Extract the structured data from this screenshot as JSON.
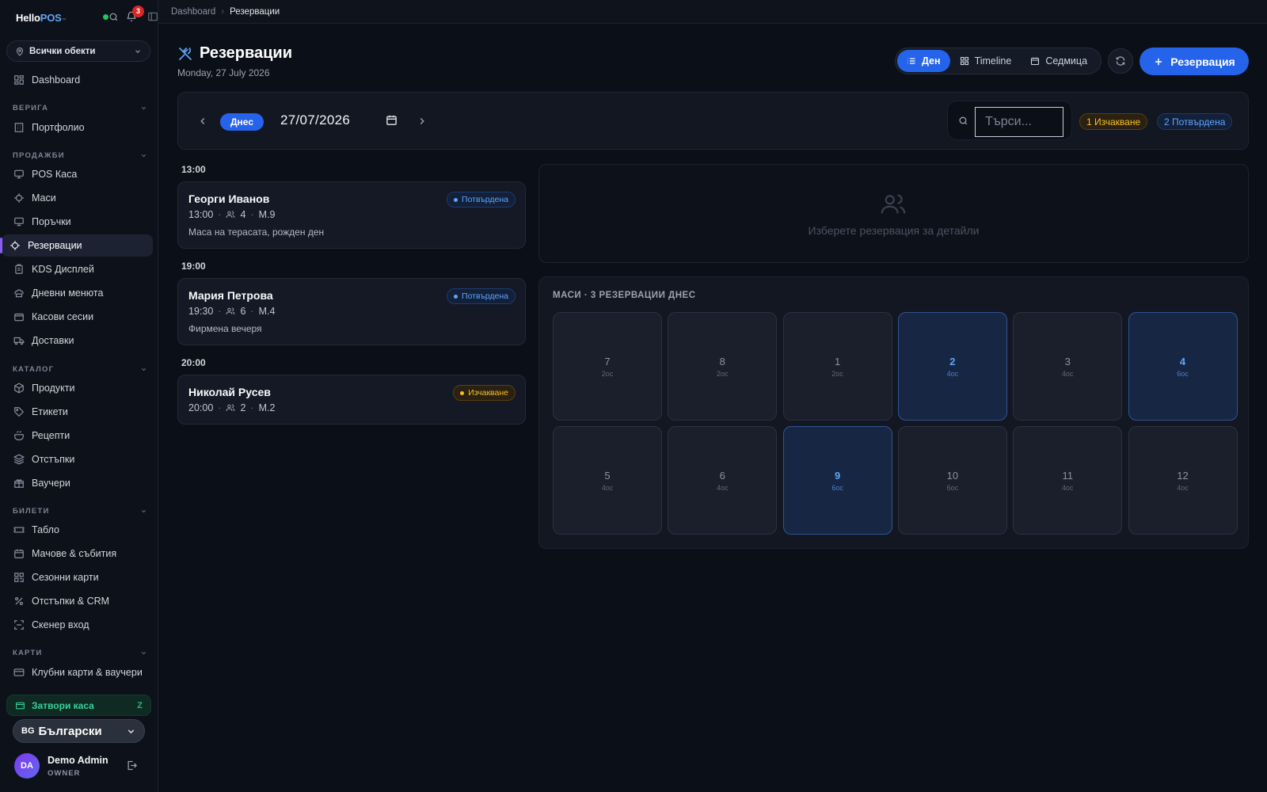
{
  "sidebar": {
    "logo_main": "Hello",
    "logo_accent": "POS",
    "logo_tm": "™",
    "notifications_count": "3",
    "venue_selector": "Всички обекти",
    "dashboard": "Dashboard",
    "sections": [
      {
        "title": "ВЕРИГА",
        "items": [
          "Портфолио"
        ]
      },
      {
        "title": "ПРОДАЖБИ",
        "items": [
          "POS Каса",
          "Маси",
          "Поръчки",
          "Резервации",
          "KDS Дисплей",
          "Дневни менюта",
          "Касови сесии",
          "Доставки"
        ]
      },
      {
        "title": "КАТАЛОГ",
        "items": [
          "Продукти",
          "Етикети",
          "Рецепти",
          "Отстъпки",
          "Ваучери"
        ]
      },
      {
        "title": "БИЛЕТИ",
        "items": [
          "Табло",
          "Мачове & събития",
          "Сезонни карти",
          "Отстъпки & CRM",
          "Скенер вход"
        ]
      },
      {
        "title": "КАРТИ",
        "items": [
          "Клубни карти & ваучери"
        ]
      }
    ],
    "active_item": "Резервации",
    "close_register": "Затвори каса",
    "close_register_key": "Z",
    "language_code": "BG",
    "language_label": "Български",
    "user": {
      "initials": "DA",
      "name": "Demo Admin",
      "role": "OWNER"
    }
  },
  "breadcrumb": {
    "root": "Dashboard",
    "current": "Резервации"
  },
  "header": {
    "title": "Резервации",
    "date_long": "Monday, 27 July 2026",
    "views": [
      "Ден",
      "Timeline",
      "Седмица"
    ],
    "active_view": "Ден",
    "new_button": "Резервация"
  },
  "datebar": {
    "today_label": "Днес",
    "date": "27/07/2026",
    "search_placeholder": "Търси...",
    "pending_pill": "1 Изчакване",
    "confirmed_pill": "2 Потвърдена"
  },
  "reservations": [
    {
      "time_group": "13:00",
      "name": "Георги Иванов",
      "time": "13:00",
      "guests": "4",
      "table": "М.9",
      "note": "Маса на терасата, рожден ден",
      "status": "Потвърдена"
    },
    {
      "time_group": "19:00",
      "name": "Мария Петрова",
      "time": "19:30",
      "guests": "6",
      "table": "М.4",
      "note": "Фирмена вечеря",
      "status": "Потвърдена"
    },
    {
      "time_group": "20:00",
      "name": "Николай Русев",
      "time": "20:00",
      "guests": "2",
      "table": "М.2",
      "note": "",
      "status": "Изчакване"
    }
  ],
  "detail_placeholder": "Изберете резервация за детайли",
  "tables": {
    "heading": "МАСИ · 3 РЕЗЕРВАЦИИ ДНЕС",
    "items": [
      {
        "number": "7",
        "capacity": "2ос",
        "booked": false
      },
      {
        "number": "8",
        "capacity": "2ос",
        "booked": false
      },
      {
        "number": "1",
        "capacity": "2ос",
        "booked": false
      },
      {
        "number": "2",
        "capacity": "4ос",
        "booked": true
      },
      {
        "number": "3",
        "capacity": "4ос",
        "booked": false
      },
      {
        "number": "4",
        "capacity": "6ос",
        "booked": true
      },
      {
        "number": "5",
        "capacity": "4ос",
        "booked": false
      },
      {
        "number": "6",
        "capacity": "4ос",
        "booked": false
      },
      {
        "number": "9",
        "capacity": "6ос",
        "booked": true
      },
      {
        "number": "10",
        "capacity": "6ос",
        "booked": false
      },
      {
        "number": "11",
        "capacity": "4ос",
        "booked": false
      },
      {
        "number": "12",
        "capacity": "4ос",
        "booked": false
      }
    ]
  },
  "colors": {
    "accent": "#2563eb",
    "confirmed": "#60a5fa",
    "pending": "#fbbf24",
    "success": "#34d399",
    "background": "#0b0f17"
  }
}
